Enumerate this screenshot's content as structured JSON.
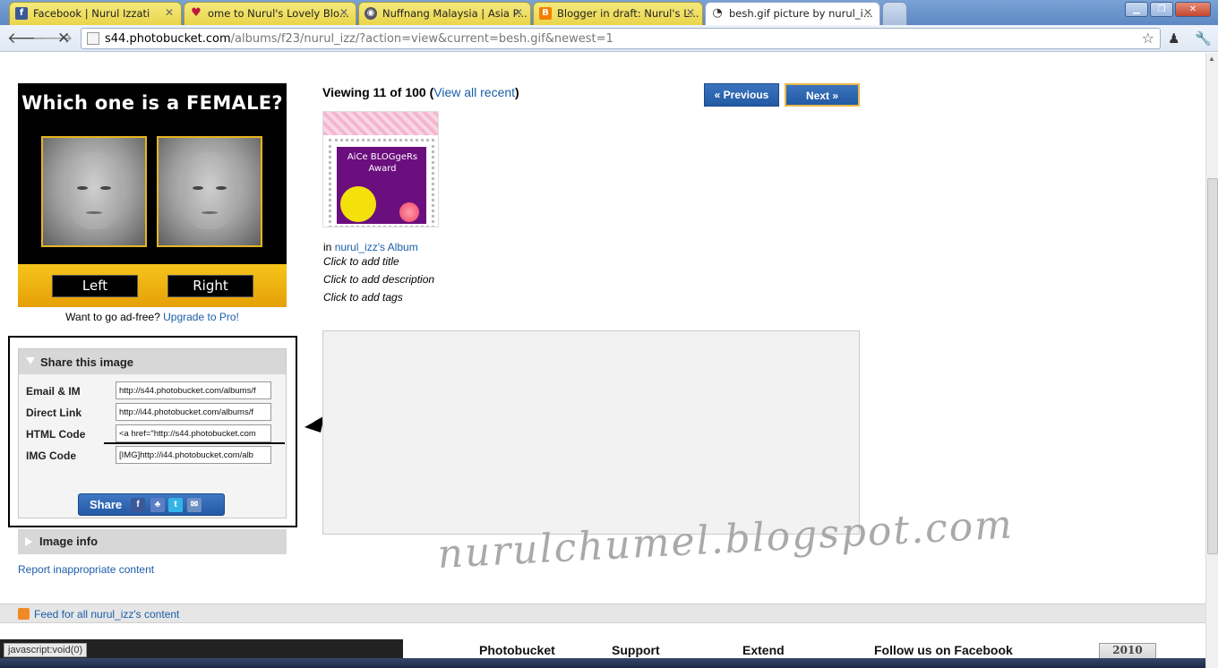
{
  "browser": {
    "tabs": [
      {
        "title": "Facebook | Nurul Izzati",
        "favicon": "facebook-icon"
      },
      {
        "title": "ome to Nurul's Lovely Blo...",
        "favicon": "heart-icon"
      },
      {
        "title": "Nuffnang Malaysia | Asia P...",
        "favicon": "nuffnang-icon"
      },
      {
        "title": "Blogger in draft: Nurul's L...",
        "favicon": "blogger-icon"
      },
      {
        "title": "besh.gif picture by nurul_i...",
        "favicon": "loading-icon"
      }
    ],
    "url_host": "s44.photobucket.com",
    "url_path": "/albums/f23/nurul_izz/?action=view&current=besh.gif&newest=1"
  },
  "ad": {
    "title": "Which one is a FEMALE?",
    "left_label": "Left",
    "right_label": "Right",
    "adfree_text": "Want to go ad-free?",
    "upgrade_link": "Upgrade to Pro!"
  },
  "share": {
    "heading": "Share this image",
    "rows": [
      {
        "label": "Email & IM",
        "value": "http://s44.photobucket.com/albums/f"
      },
      {
        "label": "Direct Link",
        "value": "http://i44.photobucket.com/albums/f"
      },
      {
        "label": "HTML Code",
        "value": "<a href=\"http://s44.photobucket.com"
      },
      {
        "label": "IMG Code",
        "value": "[IMG]http://i44.photobucket.com/alb"
      }
    ],
    "share_button": "Share"
  },
  "image_info": {
    "heading": "Image info"
  },
  "report_link": "Report inappropriate content",
  "main": {
    "viewing_prefix": "Viewing 11 of 100 (",
    "view_all": "View all recent",
    "viewing_suffix": ")",
    "prev_button": "« Previous",
    "next_button": "Next »",
    "thumb_text": "AiCe BLOGgeRs Award",
    "in_text": "in",
    "album_link": "nurul_izz's Album",
    "add_title": "Click to add title",
    "add_description": "Click to add description",
    "add_tags": "Click to add tags"
  },
  "watermark": "nurulchumel.blogspot.com",
  "feed_link": "Feed for all nurul_izz's content",
  "footer": {
    "links": [
      "Photobucket",
      "Support",
      "Extend",
      "Follow us on Facebook"
    ],
    "badge": "2010"
  },
  "status_text": "javascript:void(0)",
  "colors": {
    "link": "#1a5ea8",
    "button_blue": "#245aa5",
    "ad_yellow": "#e6b520"
  }
}
